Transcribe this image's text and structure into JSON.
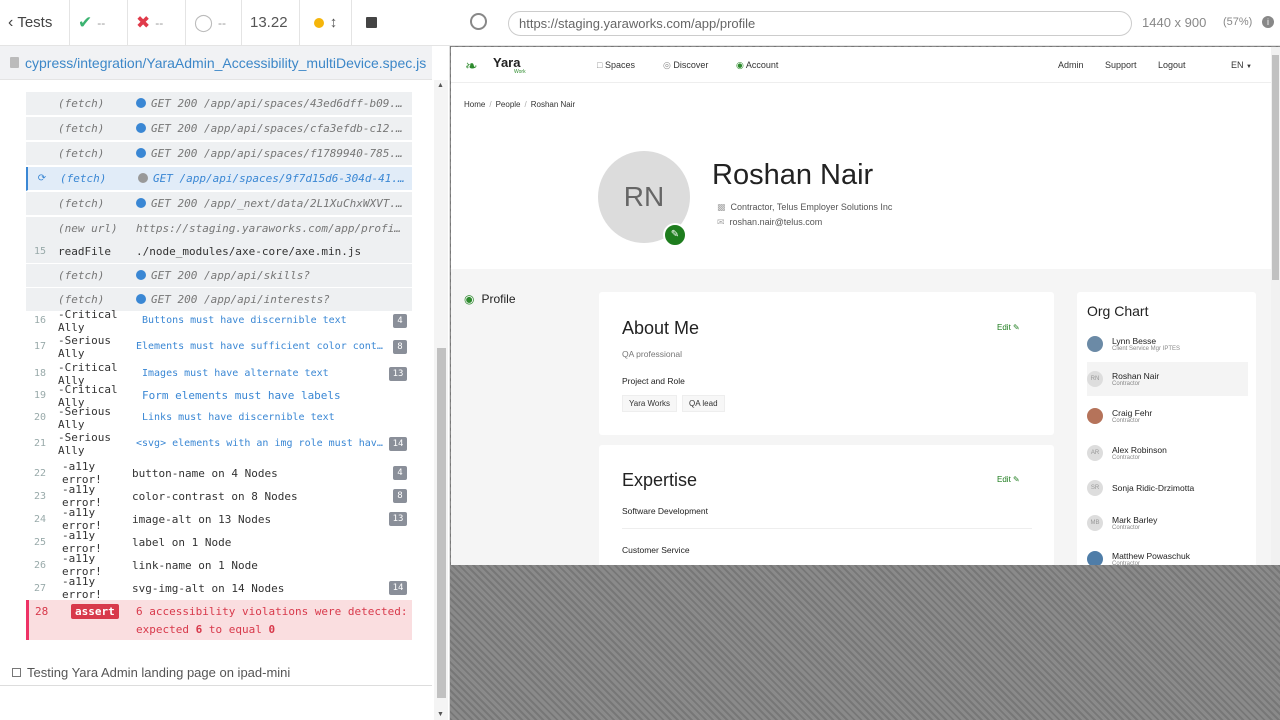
{
  "runner": {
    "back_label": "Tests",
    "passed": "--",
    "failed": "--",
    "pending": "--",
    "duration": "13.22",
    "spec_path": "cypress/integration/YaraAdmin_Accessibility_multiDevice.spec.js",
    "commands": [
      {
        "num": "",
        "name": "(fetch)",
        "msg": "GET 200 /app/api/spaces/43ed6dff-b09...",
        "dot": "blue"
      },
      {
        "num": "",
        "name": "(fetch)",
        "msg": "GET 200 /app/api/spaces/cfa3efdb-c12...",
        "dot": "blue"
      },
      {
        "num": "",
        "name": "(fetch)",
        "msg": "GET 200 /app/api/spaces/f1789940-785...",
        "dot": "blue"
      },
      {
        "num": "",
        "name": "(fetch)",
        "msg": "GET /app/api/spaces/9f7d15d6-304d-41...",
        "dot": "grey"
      },
      {
        "num": "",
        "name": "(fetch)",
        "msg": "GET 200 /app/_next/data/2L1XuChxWXVT...",
        "dot": "blue"
      },
      {
        "num": "",
        "name": "(new url)",
        "msg": "https://staging.yaraworks.com/app/profile",
        "dot": ""
      },
      {
        "num": "15",
        "name": "readFile",
        "msg": "./node_modules/axe-core/axe.min.js",
        "dot": ""
      },
      {
        "num": "",
        "name": "(fetch)",
        "msg": "GET 200 /app/api/skills?",
        "dot": "blue"
      },
      {
        "num": "",
        "name": "(fetch)",
        "msg": "GET 200 /app/api/interests?",
        "dot": "blue"
      }
    ],
    "violations": [
      {
        "num": "16",
        "name": "-Critical Ally",
        "msg": "Buttons must have discernible text",
        "count": "4"
      },
      {
        "num": "17",
        "name": "-Serious Ally",
        "msg": "Elements must have sufficient color contra...",
        "count": "8"
      },
      {
        "num": "18",
        "name": "-Critical Ally",
        "msg": "Images must have alternate text",
        "count": "13"
      },
      {
        "num": "19",
        "name": "-Critical Ally",
        "msg": "Form elements must have labels",
        "count": ""
      },
      {
        "num": "20",
        "name": "-Serious Ally",
        "msg": "Links must have discernible text",
        "count": ""
      },
      {
        "num": "21",
        "name": "-Serious Ally",
        "msg": "<svg> elements with an img role must have a...",
        "count": "14"
      }
    ],
    "errors": [
      {
        "num": "22",
        "name": "-a11y error!",
        "msg": "button-name on 4 Nodes",
        "count": "4"
      },
      {
        "num": "23",
        "name": "-a11y error!",
        "msg": "color-contrast on 8 Nodes",
        "count": "8"
      },
      {
        "num": "24",
        "name": "-a11y error!",
        "msg": "image-alt on 13 Nodes",
        "count": "13"
      },
      {
        "num": "25",
        "name": "-a11y error!",
        "msg": "label on 1 Node",
        "count": ""
      },
      {
        "num": "26",
        "name": "-a11y error!",
        "msg": "link-name on 1 Node",
        "count": ""
      },
      {
        "num": "27",
        "name": "-a11y error!",
        "msg": "svg-img-alt on 14 Nodes",
        "count": "14"
      }
    ],
    "assert": {
      "num": "28",
      "badge": "assert",
      "line1": "6 accessibility violations were detected:",
      "line2_pre": "expected",
      "expected": "6",
      "line2_mid": "to equal",
      "actual": "0"
    },
    "next_test": "Testing Yara Admin landing page on ipad-mini"
  },
  "browser": {
    "url": "https://staging.yaraworks.com/app/profile",
    "viewport_size": "1440 x 900",
    "scale": "(57%)"
  },
  "app": {
    "brand": "Yara",
    "brand_sub": "Work",
    "nav": [
      "Spaces",
      "Discover",
      "Account"
    ],
    "right_nav": [
      "Admin",
      "Support",
      "Logout",
      "EN"
    ],
    "breadcrumb": [
      "Home",
      "People",
      "Roshan Nair"
    ],
    "profile": {
      "initials": "RN",
      "name": "Roshan Nair",
      "company": "Contractor, Telus Employer Solutions Inc",
      "email": "roshan.nair@telus.com"
    },
    "side_label": "Profile",
    "about": {
      "title": "About Me",
      "edit": "Edit",
      "text": "QA professional",
      "section": "Project and Role",
      "tags": [
        "Yara Works",
        "QA lead"
      ]
    },
    "expertise": {
      "title": "Expertise",
      "edit": "Edit",
      "items": [
        "Software Development",
        "Customer Service"
      ]
    },
    "org_chart": {
      "title": "Org Chart",
      "people": [
        {
          "initials": "",
          "name": "Lynn Besse",
          "role": "Client Service Mgr IPTES"
        },
        {
          "initials": "RN",
          "name": "Roshan Nair",
          "role": "Contractor"
        },
        {
          "initials": "",
          "name": "Craig Fehr",
          "role": "Contractor"
        },
        {
          "initials": "AR",
          "name": "Alex Robinson",
          "role": "Contractor"
        },
        {
          "initials": "SR",
          "name": "Sonja Ridic-Drzimotta",
          "role": ""
        },
        {
          "initials": "MB",
          "name": "Mark Barley",
          "role": "Contractor"
        },
        {
          "initials": "",
          "name": "Matthew Powaschuk",
          "role": "Contractor"
        }
      ]
    }
  }
}
